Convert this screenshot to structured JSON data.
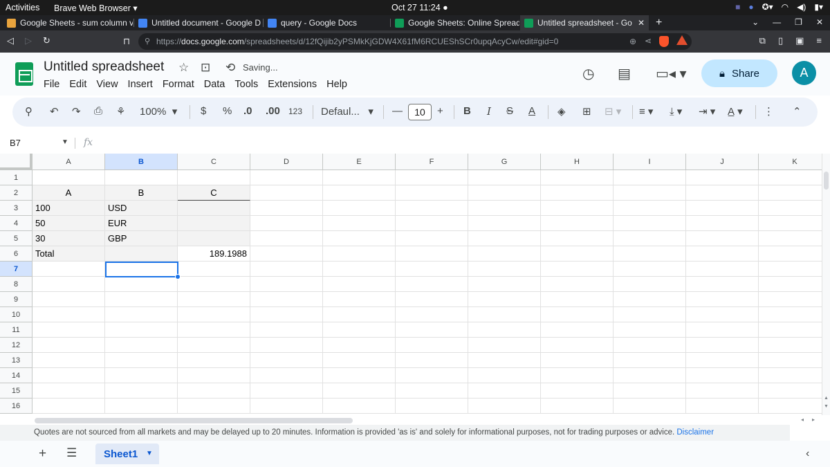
{
  "system": {
    "activities": "Activities",
    "app_name": "Brave Web Browser ▾",
    "clock": "Oct 27  11:24  ●"
  },
  "tabs": [
    {
      "label": "Google Sheets - sum column v",
      "icon_color": "#e8a33d"
    },
    {
      "label": "Untitled document - Google D",
      "icon_color": "#4285f4"
    },
    {
      "label": "query - Google Docs",
      "icon_color": "#4285f4"
    },
    {
      "label": "Google Sheets: Online Spread",
      "icon_color": "#0f9d58"
    },
    {
      "label": "Untitled spreadsheet - Go",
      "icon_color": "#0f9d58",
      "active": true
    }
  ],
  "address": {
    "url_prefix": "https://",
    "url_host": "docs.google.com",
    "url_path": "/spreadsheets/d/12fQijib2yPSMkKjGDW4X61fM6RCUEShSCr0upqAcyCw/edit#gid=0"
  },
  "docs": {
    "title": "Untitled spreadsheet",
    "status": "Saving...",
    "menu": [
      "File",
      "Edit",
      "View",
      "Insert",
      "Format",
      "Data",
      "Tools",
      "Extensions",
      "Help"
    ],
    "share_label": "Share",
    "avatar_letter": "A"
  },
  "toolbar": {
    "zoom": "100%",
    "currency": "$",
    "percent": "%",
    "dec_decrease": ".0",
    "dec_increase": ".00",
    "number_format": "123",
    "font": "Defaul...",
    "font_size": "10"
  },
  "formula_bar": {
    "name_box": "B7"
  },
  "grid": {
    "columns": [
      "A",
      "B",
      "C",
      "D",
      "E",
      "F",
      "G",
      "H",
      "I",
      "J",
      "K"
    ],
    "rows": [
      "1",
      "2",
      "3",
      "4",
      "5",
      "6",
      "7",
      "8",
      "9",
      "10",
      "11",
      "12",
      "13",
      "14",
      "15",
      "16"
    ],
    "selected_column": "B",
    "selected_row": "7",
    "cells": {
      "A2": "A",
      "B2": "B",
      "C2": "C",
      "A3": "100",
      "B3": "USD",
      "A4": "50",
      "B4": "EUR",
      "A5": "30",
      "B5": "GBP",
      "A6": "Total",
      "C6": "189.1988"
    }
  },
  "footer": {
    "disclaimer": "Quotes are not sourced from all markets and may be delayed up to 20 minutes. Information is provided 'as is' and solely for informational purposes, not for trading purposes or advice.",
    "disclaimer_link": "Disclaimer",
    "sheet_name": "Sheet1"
  }
}
